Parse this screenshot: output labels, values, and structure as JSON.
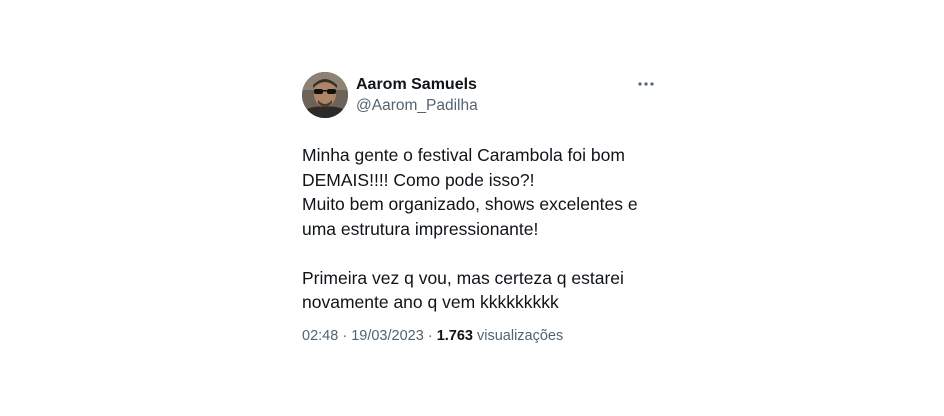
{
  "tweet": {
    "author": {
      "display_name": "Aarom Samuels",
      "handle": "@Aarom_Padilha",
      "avatar_icon": "avatar-photo"
    },
    "more_icon": "more-options-icon",
    "text": {
      "paragraphs": [
        {
          "lines": [
            "Minha gente o festival Carambola foi bom",
            "DEMAIS!!!! Como pode isso?!",
            "Muito bem organizado, shows excelentes e",
            "uma estrutura impressionante!"
          ]
        },
        {
          "lines": [
            "Primeira vez q vou, mas certeza q estarei",
            "novamente ano q vem kkkkkkkkk"
          ]
        }
      ]
    },
    "meta": {
      "time": "02:48",
      "separator": "·",
      "date": "19/03/2023",
      "views_count": "1.763",
      "views_label": "visualizações"
    }
  },
  "colors": {
    "primary_text": "#0f1419",
    "secondary_text": "#536471",
    "background": "#ffffff"
  }
}
